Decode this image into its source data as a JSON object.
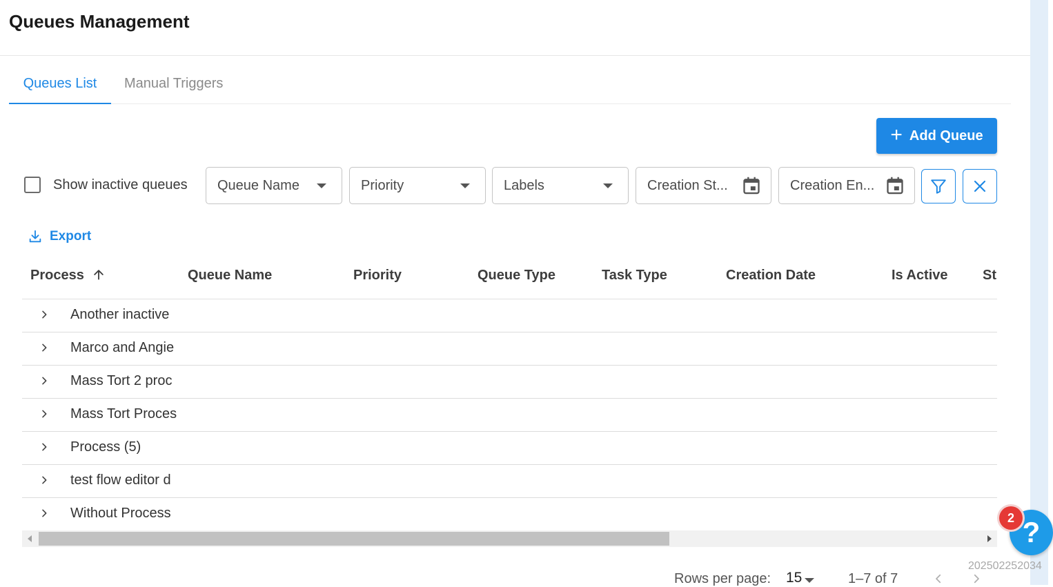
{
  "page": {
    "title": "Queues Management"
  },
  "tabs": [
    {
      "label": "Queues List",
      "active": true
    },
    {
      "label": "Manual Triggers",
      "active": false
    }
  ],
  "toolbar": {
    "add_queue_label": "Add Queue",
    "add_icon": "plus-icon"
  },
  "filters": {
    "show_inactive_label": "Show inactive queues",
    "show_inactive_checked": false,
    "queue_name": "Queue Name",
    "priority": "Priority",
    "labels": "Labels",
    "creation_start": "Creation St...",
    "creation_end": "Creation En...",
    "apply_icon": "filter-icon",
    "clear_icon": "close-icon"
  },
  "export": {
    "label": "Export",
    "icon": "download-icon"
  },
  "table": {
    "columns": [
      "Process",
      "Queue Name",
      "Priority",
      "Queue Type",
      "Task Type",
      "Creation Date",
      "Is Active",
      "St"
    ],
    "sort": {
      "column": "Process",
      "direction": "ascending",
      "icon": "arrow-up-icon"
    },
    "rows": [
      "Another inactive",
      "Marco and Angie",
      "Mass Tort 2 proc",
      "Mass Tort Proces",
      "Process (5)",
      "test flow editor d",
      "Without Process"
    ]
  },
  "pagination": {
    "rows_per_page_label": "Rows per page:",
    "rows_per_page": "15",
    "range": "1–7 of 7"
  },
  "help": {
    "badge_count": "2",
    "icon": "?"
  },
  "build_id": "202502252034",
  "colors": {
    "accent": "#1e88e5",
    "badge": "#e53935",
    "help": "#1e9be8"
  }
}
